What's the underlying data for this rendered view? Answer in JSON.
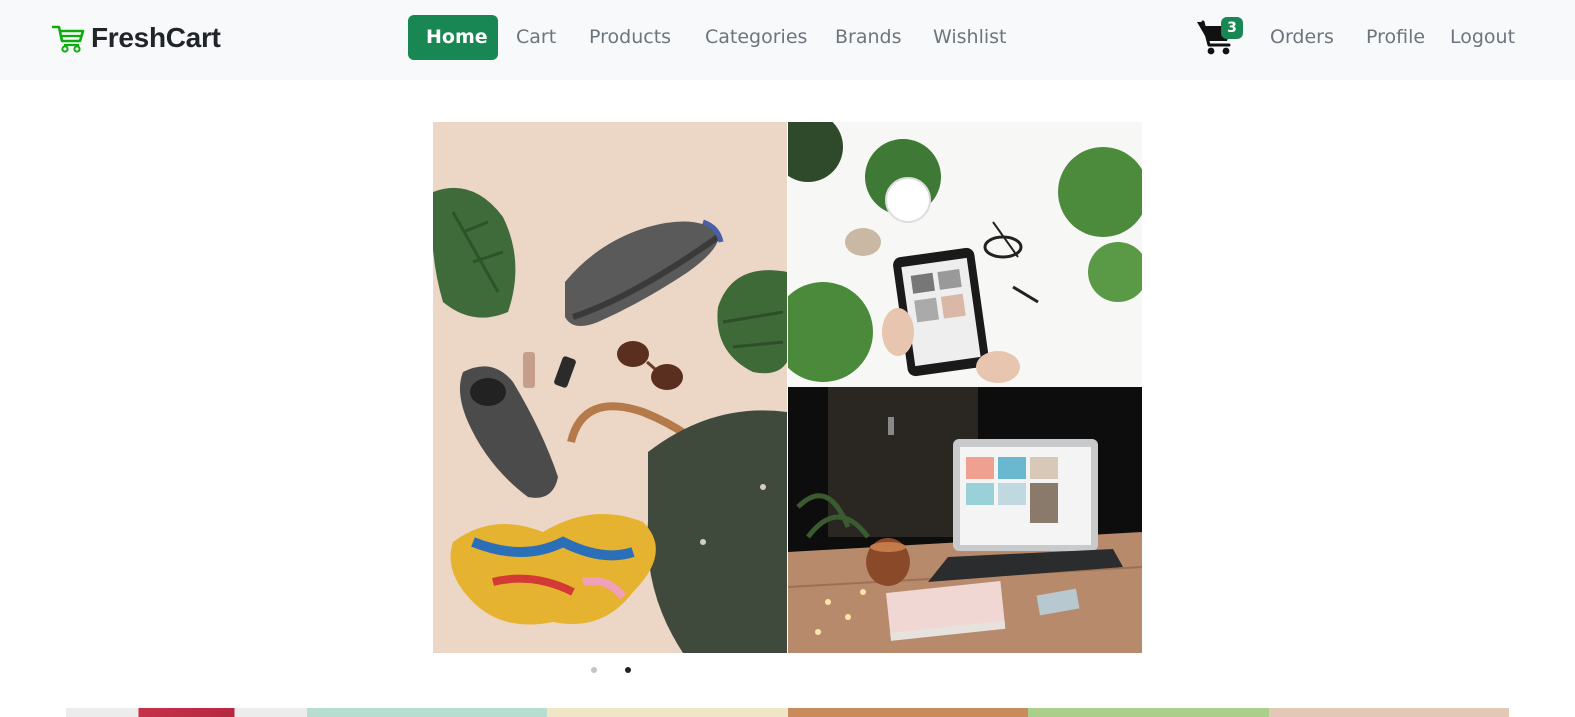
{
  "header": {
    "brand": "FreshCart",
    "nav": [
      {
        "label": "Home",
        "active": true
      },
      {
        "label": "Cart"
      },
      {
        "label": "Products"
      },
      {
        "label": "Categories"
      },
      {
        "label": "Brands"
      },
      {
        "label": "Wishlist"
      }
    ],
    "cart_count": "3",
    "right_links": [
      "Orders",
      "Profile",
      "Logout"
    ]
  },
  "slider": {
    "dots": 2,
    "active_dot": 2
  },
  "icons": {
    "logo": "shopping-cart-icon",
    "cart": "cart-icon"
  },
  "colors": {
    "accent": "#198754",
    "nav_bg": "#f8f9fa",
    "nav_link": "#6c757d",
    "brand_text": "#212529",
    "logo_icon": "#0aad0a"
  }
}
